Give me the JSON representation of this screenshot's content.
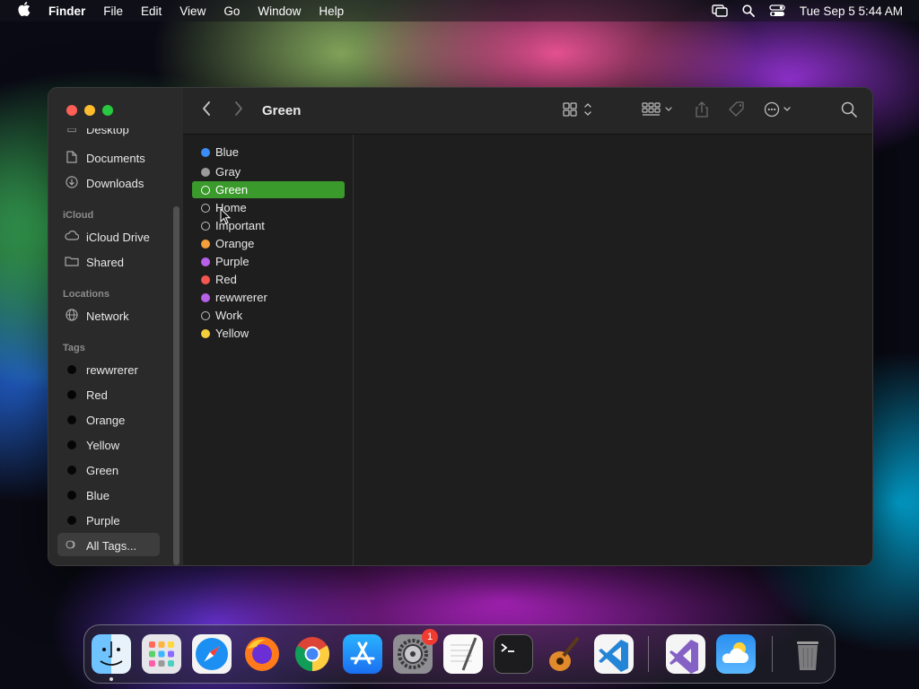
{
  "menubar": {
    "app": "Finder",
    "items": [
      "File",
      "Edit",
      "View",
      "Go",
      "Window",
      "Help"
    ],
    "clock": "Tue Sep 5  5:44 AM"
  },
  "window": {
    "title": "Green"
  },
  "sidebar": {
    "favorites": [
      {
        "label": "Desktop",
        "icon": "desktop-icon"
      },
      {
        "label": "Documents",
        "icon": "document-icon"
      },
      {
        "label": "Downloads",
        "icon": "download-icon"
      }
    ],
    "icloud_header": "iCloud",
    "icloud": [
      {
        "label": "iCloud Drive",
        "icon": "cloud-icon"
      },
      {
        "label": "Shared",
        "icon": "shared-folder-icon"
      }
    ],
    "locations_header": "Locations",
    "locations": [
      {
        "label": "Network",
        "icon": "globe-icon"
      }
    ],
    "tags_header": "Tags",
    "tags": [
      "rewwrerer",
      "Red",
      "Orange",
      "Yellow",
      "Green",
      "Blue",
      "Purple"
    ],
    "all_tags": "All Tags..."
  },
  "column": {
    "items": [
      {
        "label": "Blue",
        "color": "#3b8cf5",
        "hollow": false
      },
      {
        "label": "Gray",
        "color": "#9a9a9a",
        "hollow": false
      },
      {
        "label": "Green",
        "color": "#3fc14a",
        "hollow": false,
        "selected": true
      },
      {
        "label": "Home",
        "color": "#cccccc",
        "hollow": true
      },
      {
        "label": "Important",
        "color": "#cccccc",
        "hollow": true
      },
      {
        "label": "Orange",
        "color": "#f5a03a",
        "hollow": false
      },
      {
        "label": "Purple",
        "color": "#b661e8",
        "hollow": false
      },
      {
        "label": "Red",
        "color": "#f2564f",
        "hollow": false
      },
      {
        "label": "rewwrerer",
        "color": "#b661e8",
        "hollow": false
      },
      {
        "label": "Work",
        "color": "#cccccc",
        "hollow": true
      },
      {
        "label": "Yellow",
        "color": "#f4d03a",
        "hollow": false
      }
    ]
  },
  "dock": {
    "apps": [
      {
        "name": "finder-icon"
      },
      {
        "name": "launchpad-icon"
      },
      {
        "name": "safari-icon"
      },
      {
        "name": "firefox-icon"
      },
      {
        "name": "chrome-icon"
      },
      {
        "name": "app-store-icon"
      },
      {
        "name": "system-settings-icon",
        "badge": "1"
      },
      {
        "name": "textedit-icon"
      },
      {
        "name": "terminal-icon"
      },
      {
        "name": "garageband-icon"
      },
      {
        "name": "vscode-icon"
      },
      {
        "name": "visual-studio-icon"
      },
      {
        "name": "weather-icon"
      },
      {
        "name": "trash-icon"
      }
    ]
  }
}
